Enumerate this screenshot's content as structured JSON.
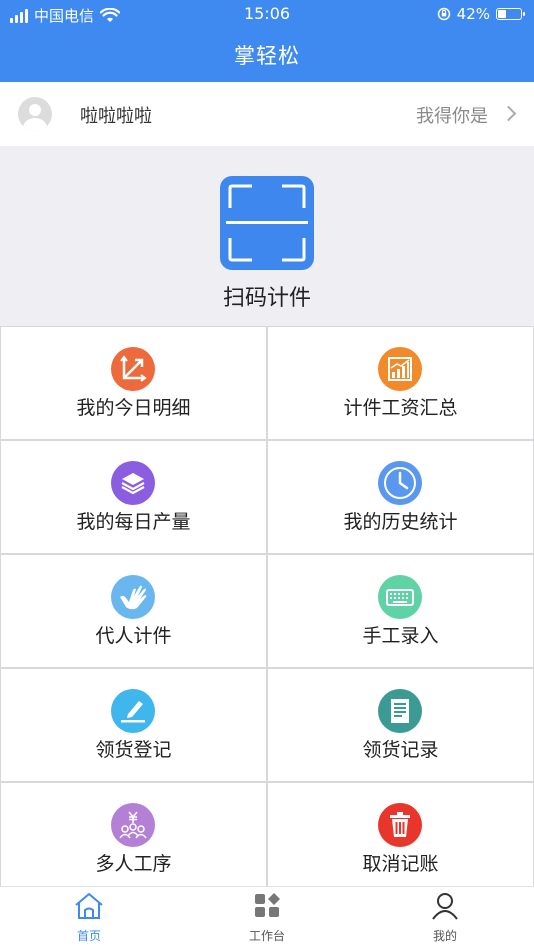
{
  "status": {
    "carrier": "中国电信",
    "time": "15:06",
    "battery_text": "42%",
    "battery_level": 0.42
  },
  "header": {
    "title": "掌轻松"
  },
  "user": {
    "name": "啦啦啦啦",
    "note": "我得你是"
  },
  "scan": {
    "label": "扫码计件",
    "color": "#3e87ee"
  },
  "menu": [
    {
      "label": "我的今日明细",
      "icon": "chart-axis-icon",
      "color": "#ec6a3b"
    },
    {
      "label": "计件工资汇总",
      "icon": "bar-chart-icon",
      "color": "#f08a2a"
    },
    {
      "label": "我的每日产量",
      "icon": "layers-icon",
      "color": "#8b5de0"
    },
    {
      "label": "我的历史统计",
      "icon": "clock-icon",
      "color": "#5a97ee"
    },
    {
      "label": "代人计件",
      "icon": "hand-icon",
      "color": "#6ab6ef"
    },
    {
      "label": "手工录入",
      "icon": "keyboard-icon",
      "color": "#5fd2a6"
    },
    {
      "label": "领货登记",
      "icon": "pen-icon",
      "color": "#3fb6ec"
    },
    {
      "label": "领货记录",
      "icon": "document-icon",
      "color": "#3c9a94"
    },
    {
      "label": "多人工序",
      "icon": "group-icon",
      "color": "#b480d6"
    },
    {
      "label": "取消记账",
      "icon": "trash-icon",
      "color": "#e8362c"
    }
  ],
  "tabs": [
    {
      "label": "首页",
      "icon": "home-icon",
      "active": true
    },
    {
      "label": "工作台",
      "icon": "workbench-icon",
      "active": false
    },
    {
      "label": "我的",
      "icon": "person-icon",
      "active": false
    }
  ],
  "accent_color": "#3f8af0"
}
